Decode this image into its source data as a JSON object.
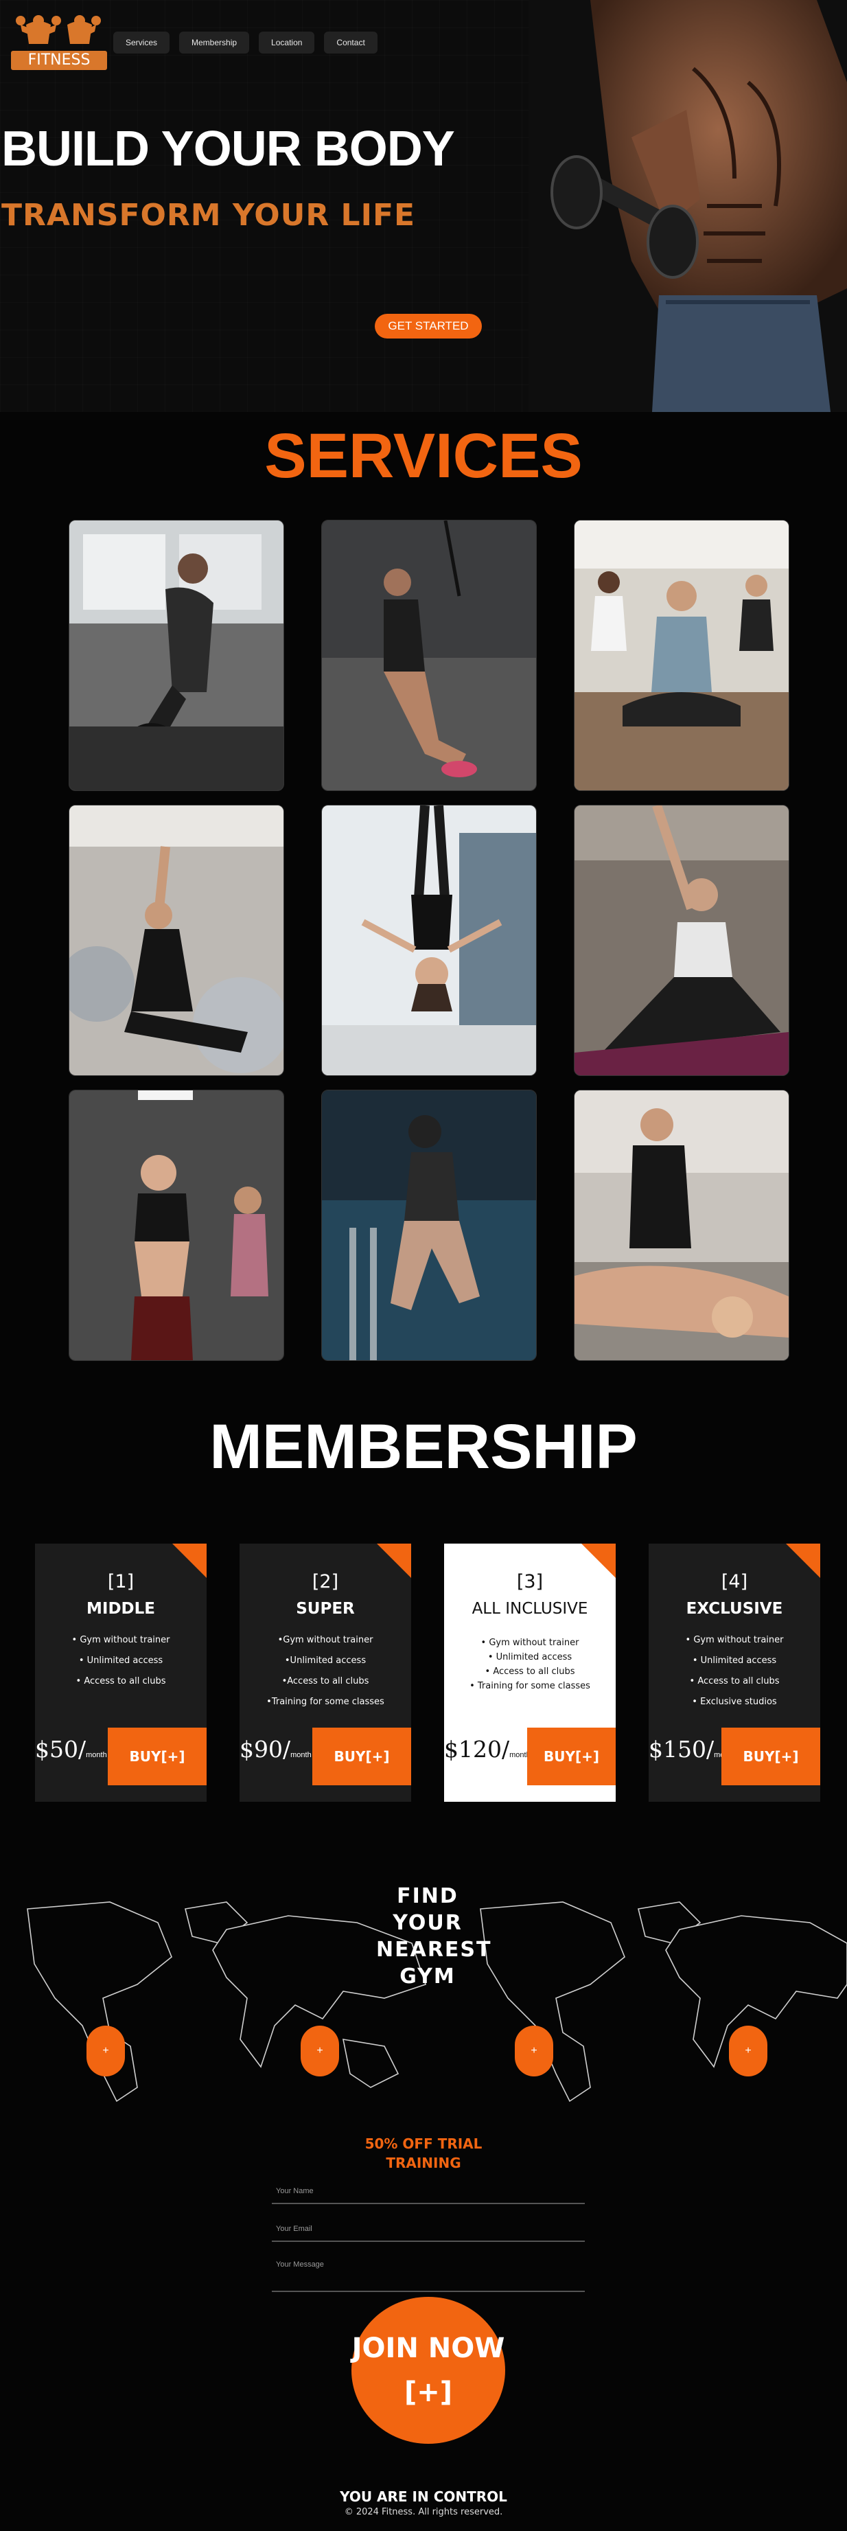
{
  "brand": {
    "logo_text": "FITNESS"
  },
  "nav": {
    "items": [
      "Services",
      "Membership",
      "Location",
      "Contact"
    ]
  },
  "hero": {
    "title": "BUILD YOUR BODY",
    "subtitle": "TRANSFORM YOUR LIFE",
    "cta": "GET STARTED"
  },
  "services": {
    "title": "SERVICES",
    "images": [
      "cycling-photo",
      "suspension-training-photo",
      "group-meditation-photo",
      "ball-stretching-photo",
      "aerial-yoga-photo",
      "yoga-stretch-photo",
      "dance-class-photo",
      "swimming-photo",
      "massage-photo"
    ]
  },
  "membership": {
    "title": "MEMBERSHIP",
    "plans": [
      {
        "num": "[1]",
        "name": "MIDDLE",
        "features": [
          "• Gym without trainer",
          "• Unlimited access",
          "• Access to all clubs"
        ],
        "price": "$50/",
        "unit": "month",
        "buy": "BUY[+]"
      },
      {
        "num": "[2]",
        "name": "SUPER",
        "features": [
          "•Gym without trainer",
          "•Unlimited access",
          "•Access to all clubs",
          "•Training for some classes"
        ],
        "price": "$90/",
        "unit": "month",
        "buy": "BUY[+]"
      },
      {
        "num": "[3]",
        "name": "ALL INCLUSIVE",
        "features": [
          "• Gym without trainer",
          "• Unlimited access",
          "• Access to all clubs",
          "• Training for some classes"
        ],
        "price": "$120/",
        "unit": "month",
        "buy": "BUY[+]"
      },
      {
        "num": "[4]",
        "name": "EXCLUSIVE",
        "features": [
          "• Gym without trainer",
          "• Unlimited access",
          "• Access to all clubs",
          "• Exclusive studios"
        ],
        "price": "$150/",
        "unit": "month",
        "buy": "BUY[+]"
      }
    ]
  },
  "locations": {
    "title_lines": [
      "FIND",
      "YOUR",
      "NEAREST",
      "GYM"
    ],
    "pin_label": "+"
  },
  "trial": {
    "title_line1": "50% OFF TRIAL",
    "title_line2": "TRAINING",
    "name_placeholder": "Your Name",
    "email_placeholder": "Your Email",
    "message_placeholder": "Your Message",
    "join_line1": "JOIN NOW",
    "join_line2": "[+]"
  },
  "footer": {
    "title": "YOU ARE IN CONTROL",
    "copyright": "© 2024 Fitness. All rights reserved."
  },
  "colors": {
    "accent": "#f26511",
    "logo": "#d9772b",
    "card": "#1c1c1c",
    "background": "#050505"
  }
}
